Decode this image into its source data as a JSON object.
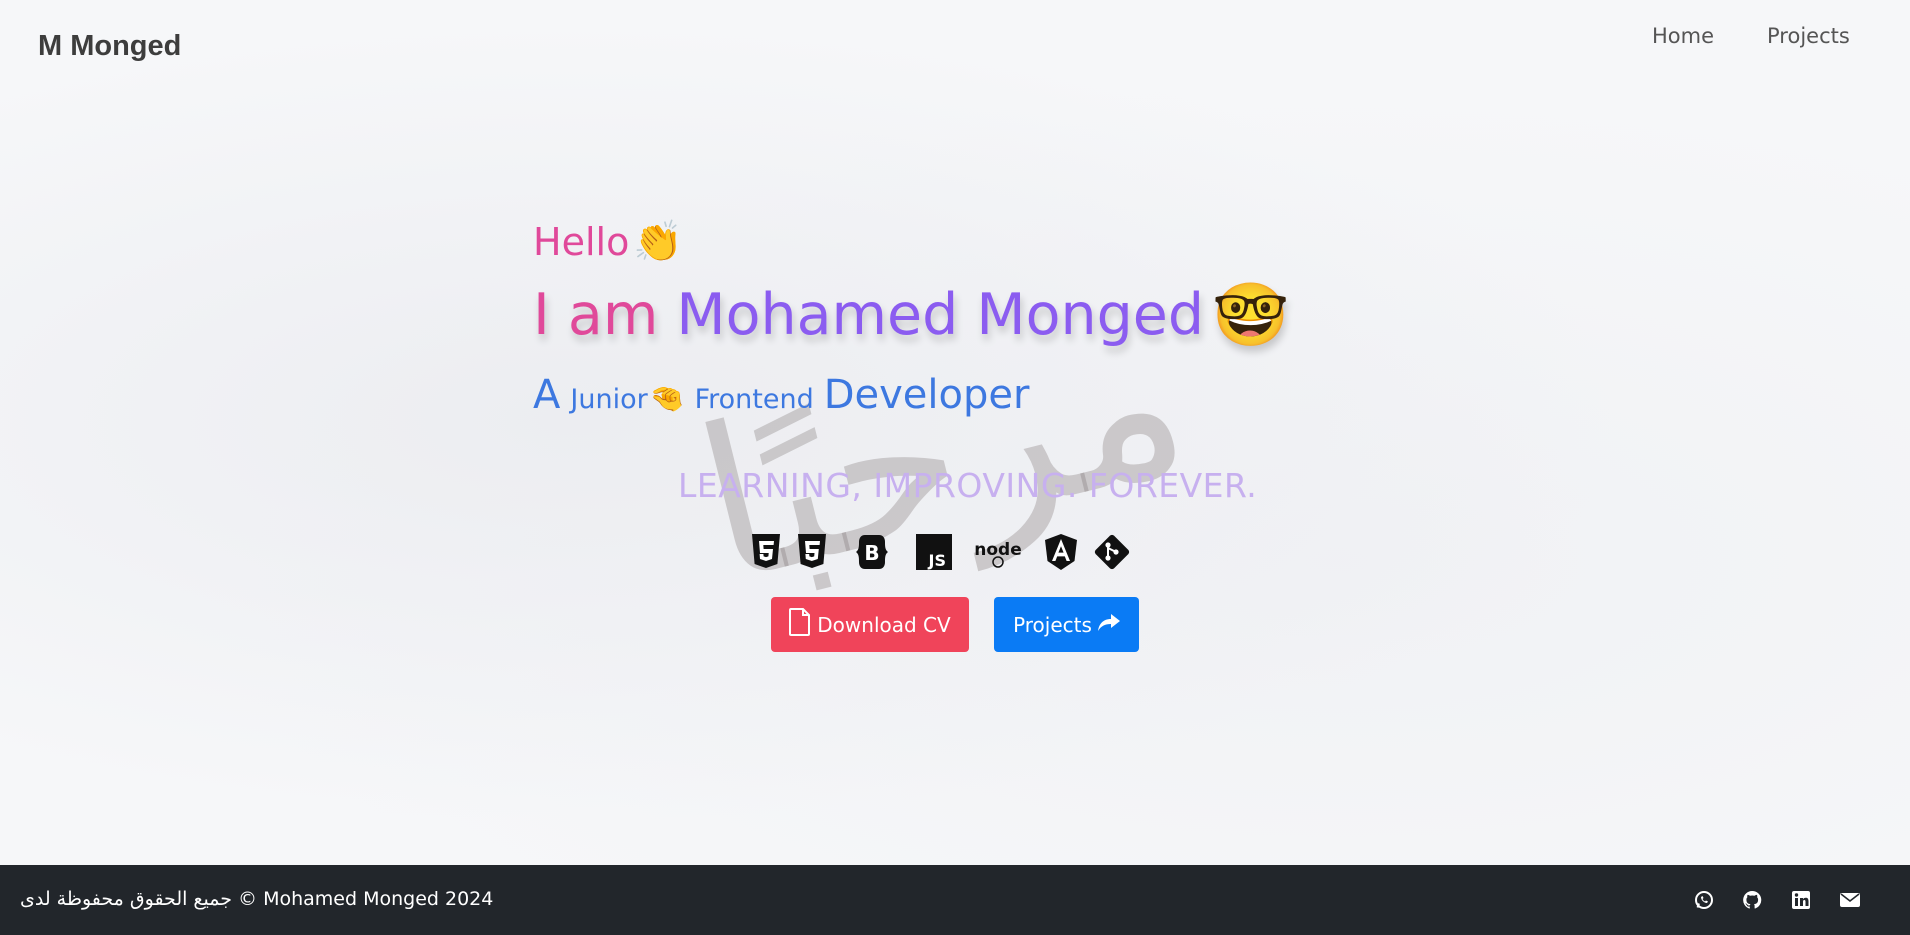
{
  "navbar": {
    "brand": "M Monged",
    "links": [
      {
        "label": "Home"
      },
      {
        "label": "Projects"
      }
    ]
  },
  "hero": {
    "greeting": "Hello",
    "greeting_emoji": "👏",
    "title_prefix": "I am",
    "title_name": "Mohamed Monged",
    "title_emoji": "🤓",
    "subtitle_a": "A",
    "subtitle_junior": "Junior",
    "subtitle_emoji": "🤏",
    "subtitle_frontend": "Frontend",
    "subtitle_developer": "Developer",
    "motto": "LEARNING, IMPROVING. FOREVER.",
    "watermark_text": "مرحبًا",
    "tech_icons": [
      "html5-icon",
      "css3-icon",
      "bootstrap-icon",
      "javascript-icon",
      "nodejs-icon",
      "angular-icon",
      "git-icon"
    ]
  },
  "buttons": {
    "download_cv": "Download CV",
    "projects": "Projects"
  },
  "footer": {
    "copyright": "جميع الحقوق محفوظة لدى © Mohamed Monged 2024",
    "social": [
      "whatsapp-icon",
      "github-icon",
      "linkedin-icon",
      "email-icon"
    ]
  },
  "colors": {
    "pink": "#e0499a",
    "purple": "#8b5cf0",
    "blue_text": "#3d78e0",
    "motto": "#c7b0ef",
    "btn_cv": "#f0445a",
    "btn_projects": "#0a7bf5",
    "footer_bg": "#22262b"
  }
}
